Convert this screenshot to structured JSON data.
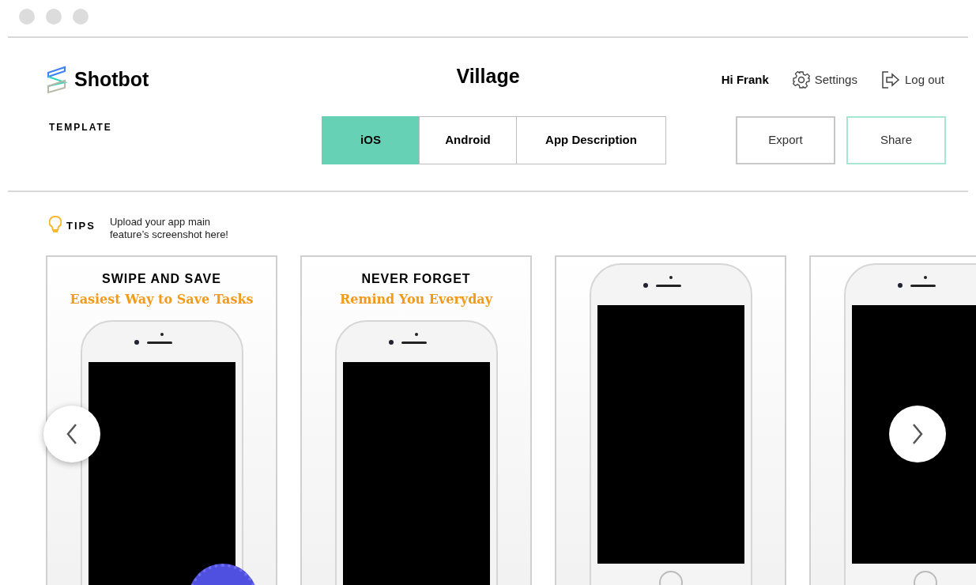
{
  "app": {
    "name": "Shotbot"
  },
  "project": {
    "title": "Village"
  },
  "user": {
    "greeting": "Hi Frank"
  },
  "header_links": [
    {
      "kind": "settings",
      "label": "Settings"
    },
    {
      "kind": "logout",
      "label": "Log out"
    }
  ],
  "section_label": "TEMPLATE",
  "tabs": [
    {
      "label": "iOS",
      "selected": true
    },
    {
      "label": "Android",
      "selected": false
    },
    {
      "label": "App Description",
      "selected": false
    }
  ],
  "actions": [
    {
      "label": "Export",
      "primary": false
    },
    {
      "label": "Share",
      "primary": true
    }
  ],
  "tips": {
    "label": "TIPS",
    "text": "Upload your app main feature’s screenshot here!"
  },
  "screenshots": [
    {
      "kind": "captioned",
      "headline": "SWIPE AND SAVE",
      "subtitle": "Easiest Way to Save Tasks",
      "badge": true
    },
    {
      "kind": "captioned",
      "headline": "NEVER FORGET",
      "subtitle": "Remind You Everyday",
      "badge": false
    },
    {
      "kind": "blank",
      "badge": false
    },
    {
      "kind": "blank",
      "badge": false
    }
  ]
}
